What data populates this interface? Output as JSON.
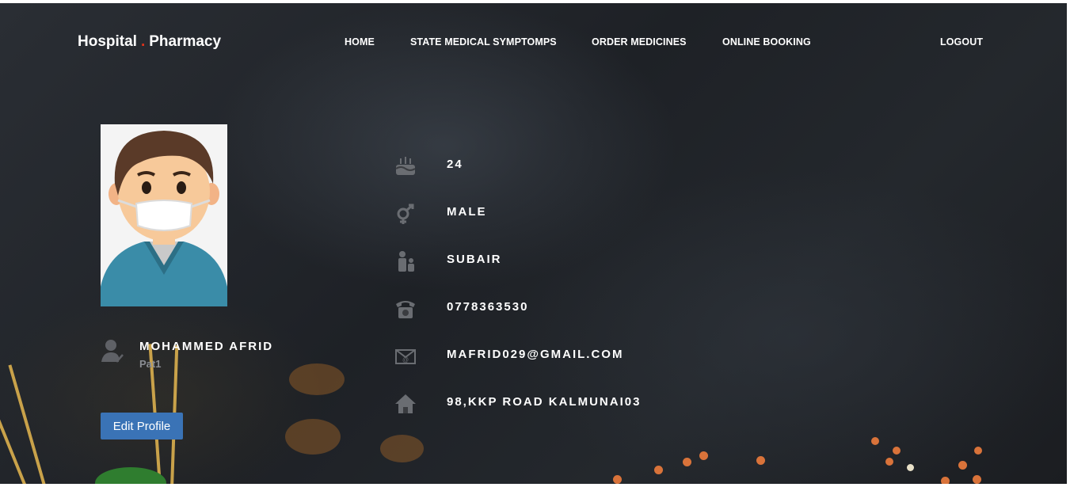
{
  "brand": {
    "name_left": "Hospital",
    "dot": ".",
    "name_right": "Pharmacy"
  },
  "nav": {
    "home": "HOME",
    "symptoms": "STATE MEDICAL SYMPTOMPS",
    "order": "ORDER MEDICINES",
    "booking": "ONLINE BOOKING",
    "logout": "LOGOUT"
  },
  "profile": {
    "name": "MOHAMMED AFRID",
    "patient_id": "Pat1",
    "edit_label": "Edit Profile"
  },
  "details": {
    "age": "24",
    "gender": "MALE",
    "guardian": "SUBAIR",
    "phone": "0778363530",
    "email": "MAFRID029@GMAIL.COM",
    "address": "98,KKP ROAD KALMUNAI03"
  },
  "icons": {
    "age": "birthday-cake-icon",
    "gender": "gender-icon",
    "guardian": "family-icon",
    "phone": "telephone-icon",
    "email": "envelope-icon",
    "address": "home-icon",
    "person": "user-check-icon"
  },
  "colors": {
    "accent_dot": "#e2331b",
    "button": "#3a73b6",
    "text": "#ffffff",
    "muted": "#8b8e93"
  }
}
